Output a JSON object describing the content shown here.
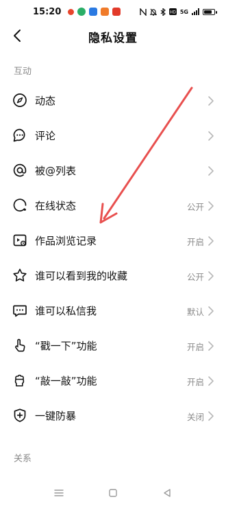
{
  "status_bar": {
    "time": "15:20",
    "app_icons": [
      {
        "name": "red-app-icon",
        "color": "#e8452c"
      },
      {
        "name": "chat-app-icon",
        "color": "#2aae67"
      },
      {
        "name": "blue-app-icon",
        "color": "#2a7ae2"
      },
      {
        "name": "orange-app-icon",
        "color": "#f07b2a"
      },
      {
        "name": "red-square-app-icon",
        "color": "#e23a2a"
      }
    ],
    "battery_level": 0.85,
    "network_label": "5G"
  },
  "header": {
    "title": "隐私设置",
    "back_icon": "back-arrow-icon"
  },
  "sections": {
    "interaction_label": "互动",
    "relations_label": "关系"
  },
  "rows": [
    {
      "label": "动态",
      "value": "",
      "icon": "compass-icon"
    },
    {
      "label": "评论",
      "value": "",
      "icon": "comment-icon"
    },
    {
      "label": "被@列表",
      "value": "",
      "icon": "at-icon"
    },
    {
      "label": "在线状态",
      "value": "公开",
      "icon": "online-status-icon"
    },
    {
      "label": "作品浏览记录",
      "value": "开启",
      "icon": "view-history-icon"
    },
    {
      "label": "谁可以看到我的收藏",
      "value": "公开",
      "icon": "star-icon"
    },
    {
      "label": "谁可以私信我",
      "value": "默认",
      "icon": "message-icon"
    },
    {
      "label": "“戳一下”功能",
      "value": "开启",
      "icon": "poke-hand-icon"
    },
    {
      "label": "“敲一敲”功能",
      "value": "开启",
      "icon": "knock-hand-icon"
    },
    {
      "label": "一键防暴",
      "value": "关闭",
      "icon": "shield-plus-icon"
    }
  ],
  "colors": {
    "annotation_arrow": "#e8504f",
    "secondary_text": "#8a8a8a"
  }
}
